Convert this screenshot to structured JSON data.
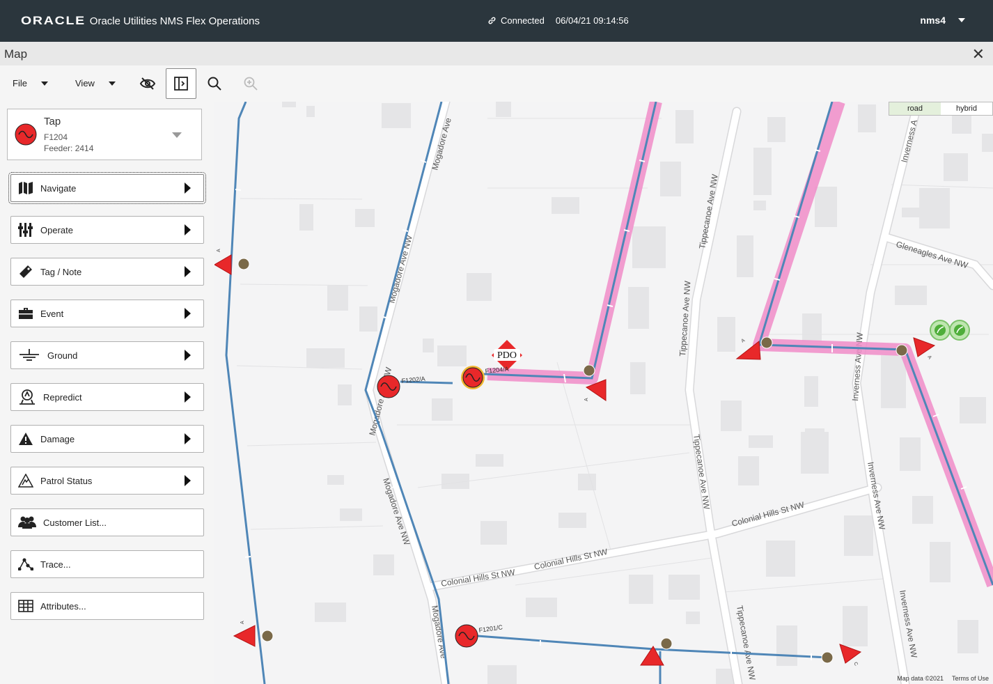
{
  "header": {
    "logo": "ORACLE",
    "title": "Oracle Utilities NMS Flex Operations",
    "connection_status": "Connected",
    "timestamp": "06/04/21 09:14:56",
    "user": "nms4"
  },
  "window": {
    "title": "Map"
  },
  "toolbar": {
    "file_label": "File",
    "view_label": "View"
  },
  "tap_card": {
    "title": "Tap",
    "device": "F1204",
    "feeder": "Feeder: 2414"
  },
  "actions": [
    {
      "label": "Navigate"
    },
    {
      "label": "Operate"
    },
    {
      "label": "Tag / Note"
    },
    {
      "label": "Event"
    },
    {
      "label": "Ground"
    },
    {
      "label": "Repredict"
    },
    {
      "label": "Damage"
    },
    {
      "label": "Patrol Status"
    },
    {
      "label": "Customer List..."
    },
    {
      "label": "Trace..."
    },
    {
      "label": "Attributes..."
    }
  ],
  "map": {
    "type_buttons": {
      "road": "road",
      "hybrid": "hybrid",
      "active": "road"
    },
    "attribution": "Map data ©2021",
    "terms": "Terms of Use",
    "streets": {
      "mogadore_1": "Mogadore Ave",
      "mogadore_2": "Mogadore Ave NW",
      "mogadore_3": "Mogadore Ave NW",
      "mogadore_4": "Mogadore Ave NW",
      "mogadore_5": "Mogadore Ave",
      "tippecanoe_1": "Tippecanoe Ave NW",
      "tippecanoe_2": "Tippecanoe Ave NW",
      "tippecanoe_3": "Tippecanoe Ave NW",
      "tippecanoe_4": "Tippecanoe Ave NW",
      "inverness_1": "Inverness A",
      "inverness_2": "Inverness Ave NW",
      "inverness_3": "Inverness Ave NW",
      "inverness_4": "Inverness Ave NW",
      "gleneagles": "Gleneagles Ave NW",
      "colonial_1": "Colonial Hills St NW",
      "colonial_2": "Colonial Hills St NW",
      "colonial_3": "Colonial Hills St NW"
    },
    "device_labels": {
      "f1202a": "F1202/A",
      "f1204": "F1204/A",
      "f1201c": "F1201/C",
      "pdo": "PDO"
    },
    "phase_labels": [
      "A",
      "A",
      "A",
      "A",
      "A",
      "C"
    ],
    "colors": {
      "feeder_line": "#4f86b7",
      "highlight": "#f08cc8",
      "device_red": "#e8282a",
      "switch_brown": "#7a6948",
      "road": "#ffffff",
      "building": "#e4e4e6"
    }
  }
}
